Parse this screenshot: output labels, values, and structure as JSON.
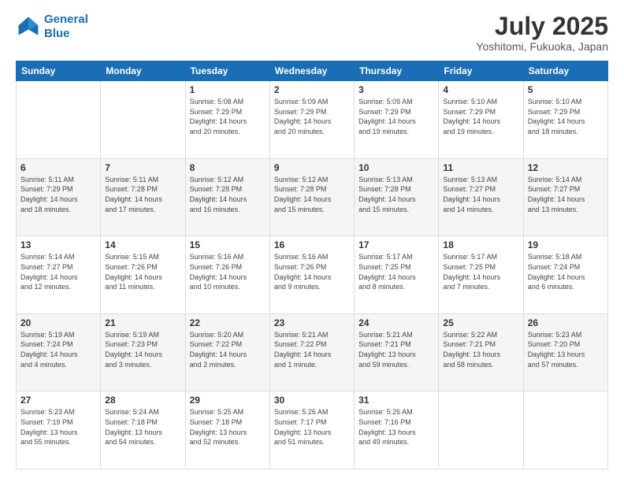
{
  "logo": {
    "line1": "General",
    "line2": "Blue"
  },
  "title": "July 2025",
  "subtitle": "Yoshitomi, Fukuoka, Japan",
  "weekdays": [
    "Sunday",
    "Monday",
    "Tuesday",
    "Wednesday",
    "Thursday",
    "Friday",
    "Saturday"
  ],
  "weeks": [
    [
      {
        "day": "",
        "info": ""
      },
      {
        "day": "",
        "info": ""
      },
      {
        "day": "1",
        "info": "Sunrise: 5:08 AM\nSunset: 7:29 PM\nDaylight: 14 hours\nand 20 minutes."
      },
      {
        "day": "2",
        "info": "Sunrise: 5:09 AM\nSunset: 7:29 PM\nDaylight: 14 hours\nand 20 minutes."
      },
      {
        "day": "3",
        "info": "Sunrise: 5:09 AM\nSunset: 7:29 PM\nDaylight: 14 hours\nand 19 minutes."
      },
      {
        "day": "4",
        "info": "Sunrise: 5:10 AM\nSunset: 7:29 PM\nDaylight: 14 hours\nand 19 minutes."
      },
      {
        "day": "5",
        "info": "Sunrise: 5:10 AM\nSunset: 7:29 PM\nDaylight: 14 hours\nand 18 minutes."
      }
    ],
    [
      {
        "day": "6",
        "info": "Sunrise: 5:11 AM\nSunset: 7:29 PM\nDaylight: 14 hours\nand 18 minutes."
      },
      {
        "day": "7",
        "info": "Sunrise: 5:11 AM\nSunset: 7:28 PM\nDaylight: 14 hours\nand 17 minutes."
      },
      {
        "day": "8",
        "info": "Sunrise: 5:12 AM\nSunset: 7:28 PM\nDaylight: 14 hours\nand 16 minutes."
      },
      {
        "day": "9",
        "info": "Sunrise: 5:12 AM\nSunset: 7:28 PM\nDaylight: 14 hours\nand 15 minutes."
      },
      {
        "day": "10",
        "info": "Sunrise: 5:13 AM\nSunset: 7:28 PM\nDaylight: 14 hours\nand 15 minutes."
      },
      {
        "day": "11",
        "info": "Sunrise: 5:13 AM\nSunset: 7:27 PM\nDaylight: 14 hours\nand 14 minutes."
      },
      {
        "day": "12",
        "info": "Sunrise: 5:14 AM\nSunset: 7:27 PM\nDaylight: 14 hours\nand 13 minutes."
      }
    ],
    [
      {
        "day": "13",
        "info": "Sunrise: 5:14 AM\nSunset: 7:27 PM\nDaylight: 14 hours\nand 12 minutes."
      },
      {
        "day": "14",
        "info": "Sunrise: 5:15 AM\nSunset: 7:26 PM\nDaylight: 14 hours\nand 11 minutes."
      },
      {
        "day": "15",
        "info": "Sunrise: 5:16 AM\nSunset: 7:26 PM\nDaylight: 14 hours\nand 10 minutes."
      },
      {
        "day": "16",
        "info": "Sunrise: 5:16 AM\nSunset: 7:26 PM\nDaylight: 14 hours\nand 9 minutes."
      },
      {
        "day": "17",
        "info": "Sunrise: 5:17 AM\nSunset: 7:25 PM\nDaylight: 14 hours\nand 8 minutes."
      },
      {
        "day": "18",
        "info": "Sunrise: 5:17 AM\nSunset: 7:25 PM\nDaylight: 14 hours\nand 7 minutes."
      },
      {
        "day": "19",
        "info": "Sunrise: 5:18 AM\nSunset: 7:24 PM\nDaylight: 14 hours\nand 6 minutes."
      }
    ],
    [
      {
        "day": "20",
        "info": "Sunrise: 5:19 AM\nSunset: 7:24 PM\nDaylight: 14 hours\nand 4 minutes."
      },
      {
        "day": "21",
        "info": "Sunrise: 5:19 AM\nSunset: 7:23 PM\nDaylight: 14 hours\nand 3 minutes."
      },
      {
        "day": "22",
        "info": "Sunrise: 5:20 AM\nSunset: 7:22 PM\nDaylight: 14 hours\nand 2 minutes."
      },
      {
        "day": "23",
        "info": "Sunrise: 5:21 AM\nSunset: 7:22 PM\nDaylight: 14 hours\nand 1 minute."
      },
      {
        "day": "24",
        "info": "Sunrise: 5:21 AM\nSunset: 7:21 PM\nDaylight: 13 hours\nand 59 minutes."
      },
      {
        "day": "25",
        "info": "Sunrise: 5:22 AM\nSunset: 7:21 PM\nDaylight: 13 hours\nand 58 minutes."
      },
      {
        "day": "26",
        "info": "Sunrise: 5:23 AM\nSunset: 7:20 PM\nDaylight: 13 hours\nand 57 minutes."
      }
    ],
    [
      {
        "day": "27",
        "info": "Sunrise: 5:23 AM\nSunset: 7:19 PM\nDaylight: 13 hours\nand 55 minutes."
      },
      {
        "day": "28",
        "info": "Sunrise: 5:24 AM\nSunset: 7:18 PM\nDaylight: 13 hours\nand 54 minutes."
      },
      {
        "day": "29",
        "info": "Sunrise: 5:25 AM\nSunset: 7:18 PM\nDaylight: 13 hours\nand 52 minutes."
      },
      {
        "day": "30",
        "info": "Sunrise: 5:26 AM\nSunset: 7:17 PM\nDaylight: 13 hours\nand 51 minutes."
      },
      {
        "day": "31",
        "info": "Sunrise: 5:26 AM\nSunset: 7:16 PM\nDaylight: 13 hours\nand 49 minutes."
      },
      {
        "day": "",
        "info": ""
      },
      {
        "day": "",
        "info": ""
      }
    ]
  ]
}
